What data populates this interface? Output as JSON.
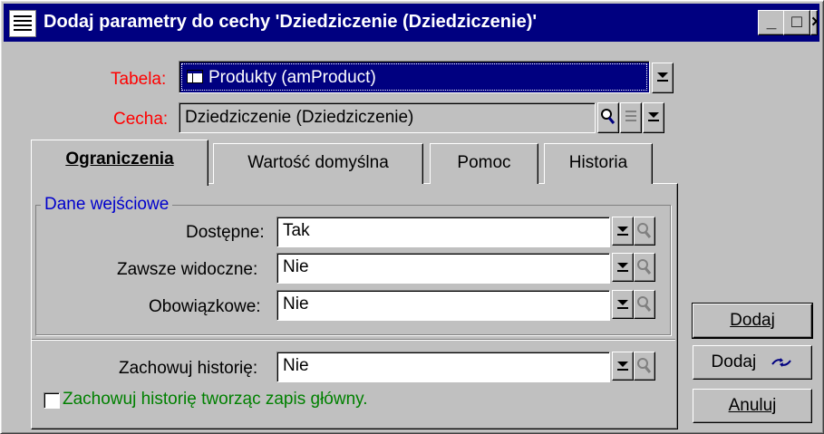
{
  "window": {
    "title": "Dodaj parametry do cechy 'Dziedziczenie (Dziedziczenie)'",
    "title_buttons": [
      "_",
      "□",
      "×"
    ]
  },
  "top": {
    "tabela_label": "Tabela:",
    "tabela_value": "Produkty (amProduct)",
    "cecha_label": "Cecha:",
    "cecha_value": "Dziedziczenie (Dziedziczenie)"
  },
  "tabs": [
    {
      "label": "Ograniczenia",
      "active": true
    },
    {
      "label": "Wartość domyślna",
      "active": false
    },
    {
      "label": "Pomoc",
      "active": false
    },
    {
      "label": "Historia",
      "active": false
    }
  ],
  "group": {
    "title": "Dane wejściowe",
    "rows": [
      {
        "label": "Dostępne:",
        "value": "Tak"
      },
      {
        "label": "Zawsze widoczne:",
        "value": "Nie"
      },
      {
        "label": "Obowiązkowe:",
        "value": "Nie"
      }
    ]
  },
  "history": {
    "label": "Zachowuj historię:",
    "value": "Nie"
  },
  "checkbox": {
    "label": "Zachowuj historię tworząc zapis główny.",
    "checked": false
  },
  "buttons": {
    "dodaj": "Dodaj",
    "dodaj_kontynuuj": "Dodaj",
    "anuluj": "Anuluj"
  },
  "colors": {
    "titlebar": "#000080",
    "required_label": "#ff0000",
    "group_title": "#0000cc",
    "checkbox_label": "#008000",
    "face": "#c0c0c0"
  }
}
